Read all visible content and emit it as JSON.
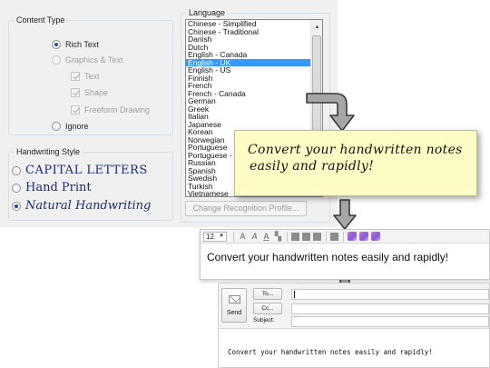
{
  "content_type": {
    "title": "Content Type",
    "options": {
      "rich_text": "Rich Text",
      "graphics_text": "Graphics & Text",
      "text": "Text",
      "shape": "Shape",
      "freeform_drawing": "Freeform Drawing",
      "ignore": "Ignore"
    },
    "selected": "Rich Text"
  },
  "handwriting_style": {
    "title": "Handwriting Style",
    "options": {
      "capital_letters": "CAPITAL LETTERS",
      "hand_print": "Hand Print",
      "natural_handwriting": "Natural Handwriting"
    },
    "selected": "Natural Handwriting"
  },
  "language": {
    "title": "Language",
    "items": [
      "Chinese - Simplified",
      "Chinese - Traditional",
      "Danish",
      "Dutch",
      "English - Canada",
      "English - UK",
      "English - US",
      "Finnish",
      "French",
      "French - Canada",
      "German",
      "Greek",
      "Italian",
      "Japanese",
      "Korean",
      "Norwegian",
      "Portuguese",
      "Portuguese - Brazil",
      "Russian",
      "Spanish",
      "Swedish",
      "Turkish",
      "Vietnamese"
    ],
    "selected": "English - UK",
    "change_button": "Change Recognition Profile..."
  },
  "sticky_note": {
    "text_line1": "Convert your handwritten notes",
    "text_line2": "easily and rapidly!"
  },
  "editor": {
    "font_size": "12",
    "text": "Convert your handwritten notes easily and rapidly!"
  },
  "email": {
    "send_label": "Send",
    "to_label": "To...",
    "cc_label": "Cc...",
    "subject_label": "Subject:",
    "body": "Convert your handwritten notes easily and rapidly!"
  },
  "colors": {
    "selection": "#3399ff",
    "sticky_note": "#fcfcc4",
    "panel_bg": "#f0f0f0",
    "arrow_fill": "#a6a6a6"
  }
}
